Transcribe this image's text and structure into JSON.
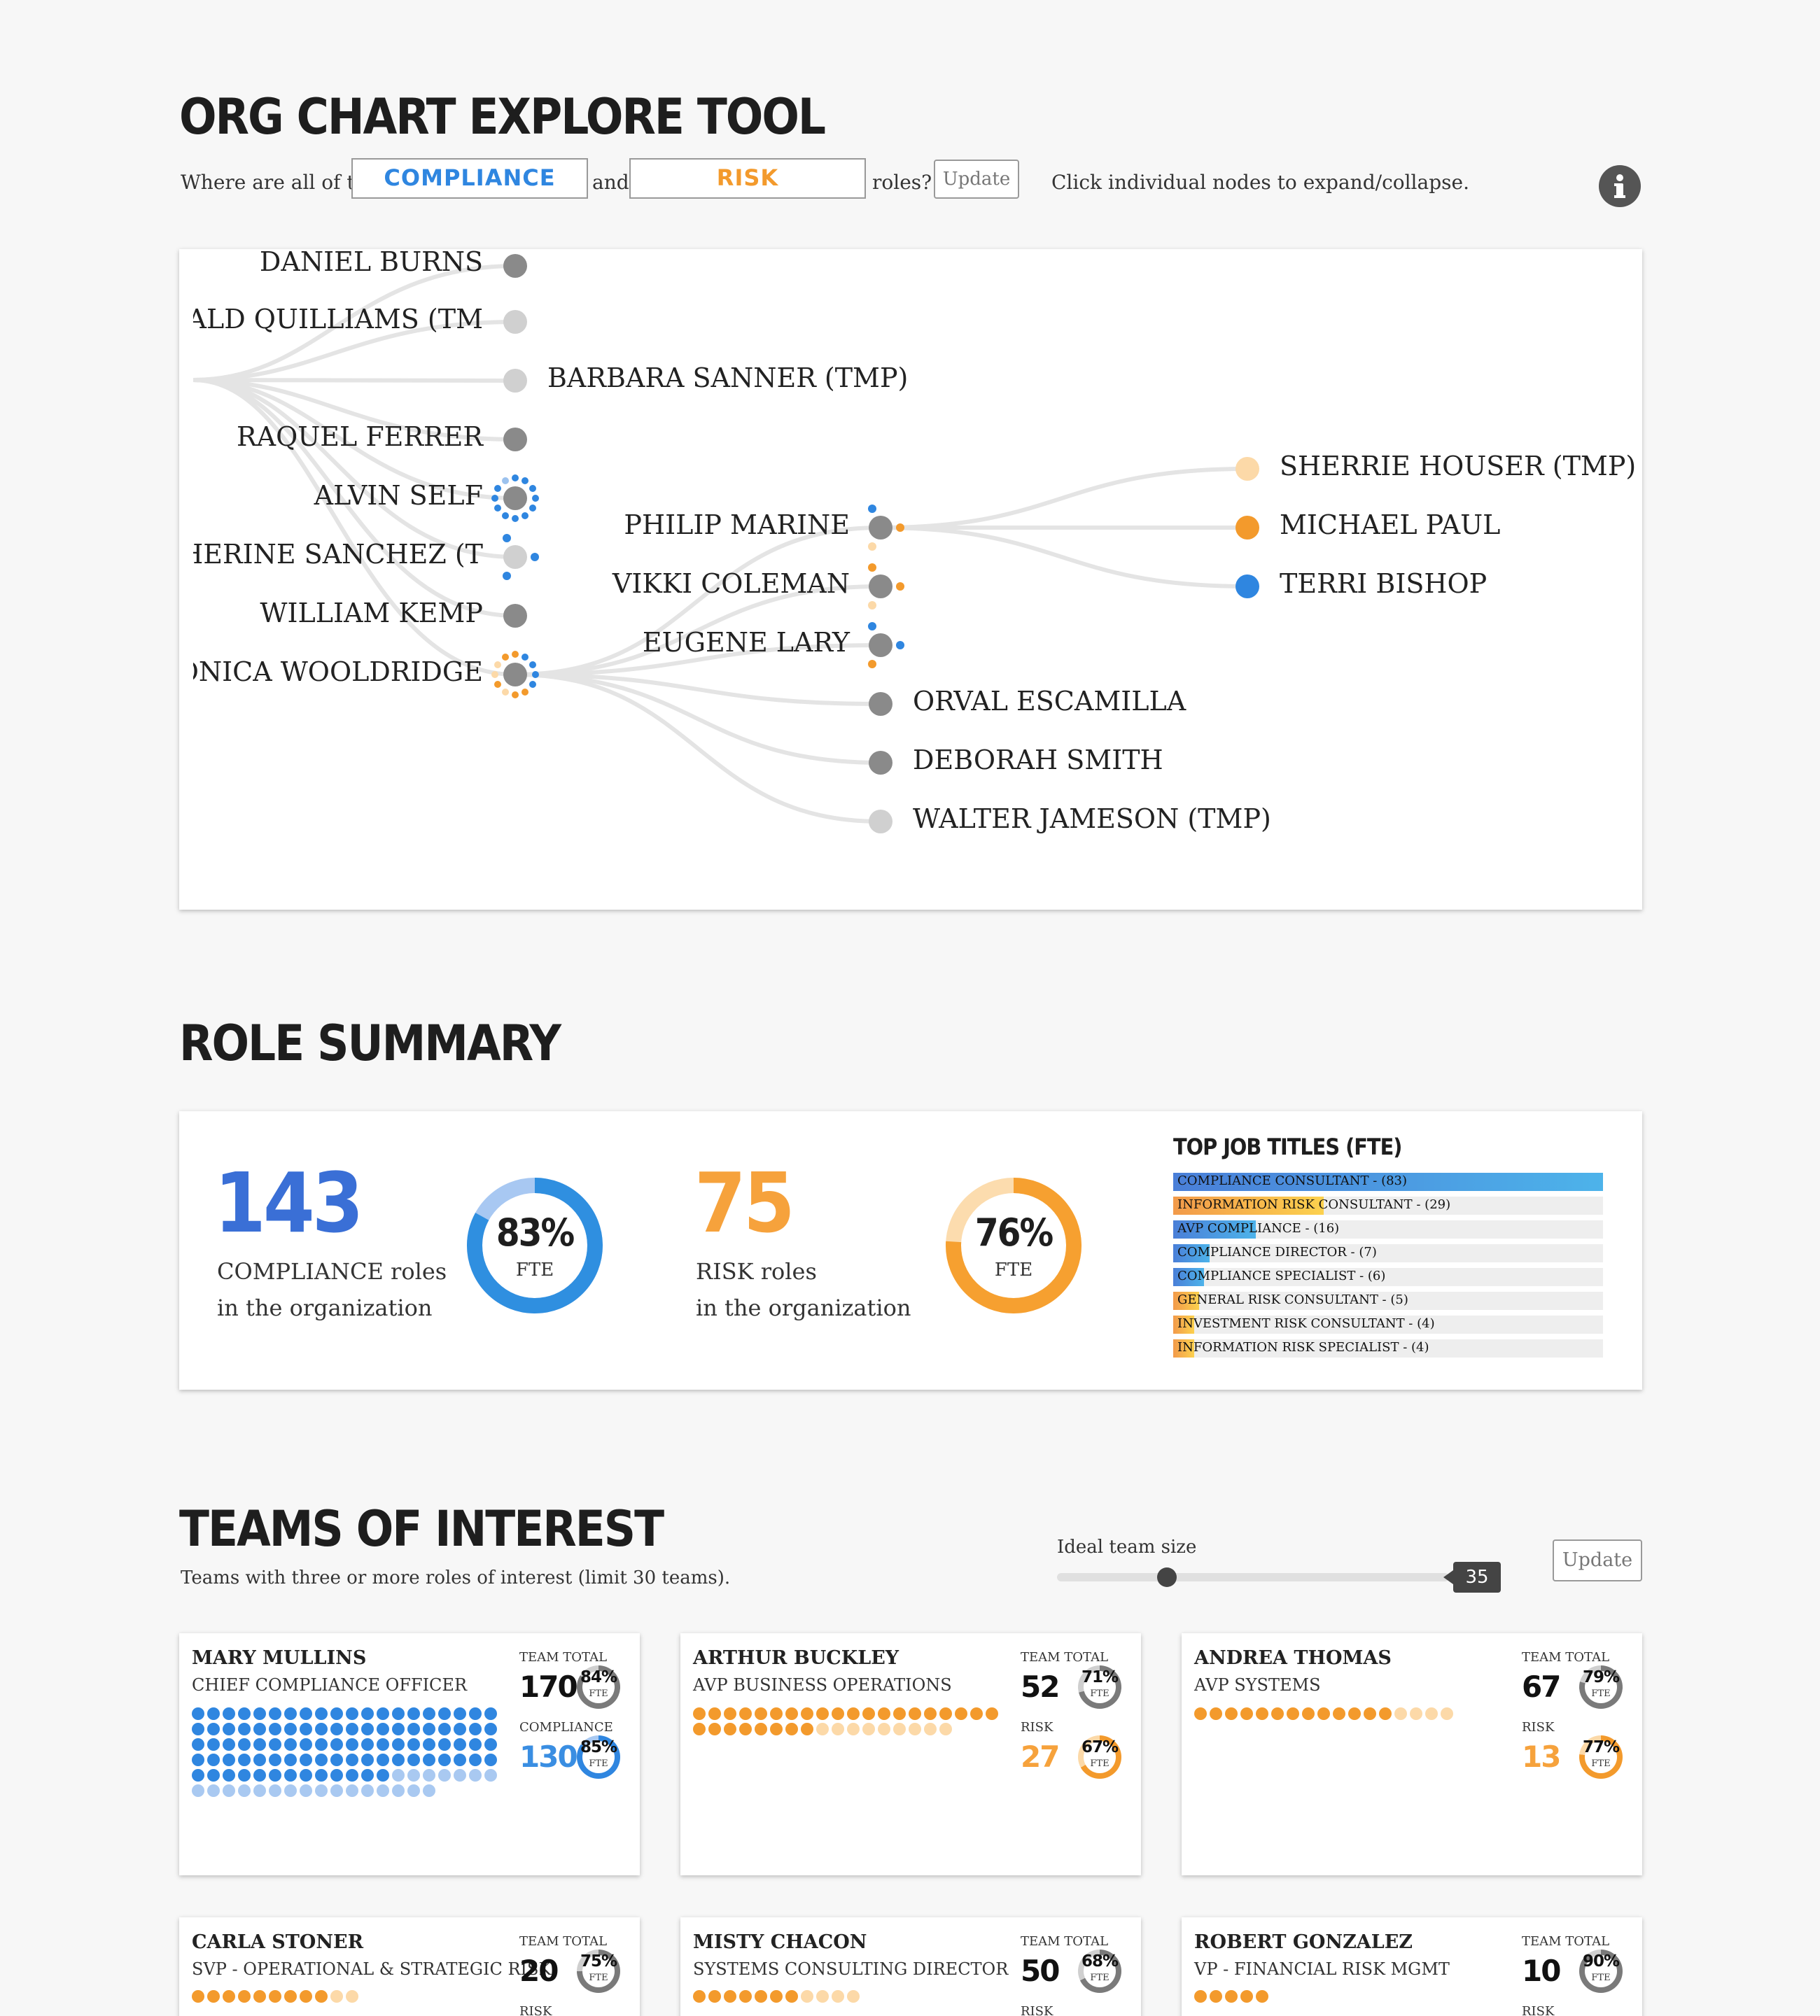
{
  "header": {
    "title": "ORG CHART EXPLORE TOOL",
    "prompt_prefix": "Where are all of the",
    "role1": "COMPLIANCE",
    "connector": "and",
    "role2": "RISK",
    "prompt_suffix": "roles?",
    "update_label": "Update",
    "hint": "Click individual nodes to expand/collapse."
  },
  "colors": {
    "compliance": "#2f86e0",
    "risk": "#f39a2c",
    "node_gray": "#8a8a8a"
  },
  "org_chart": {
    "level1": [
      "DANIEL BURNS",
      "ONALD QUILLIAMS (TM",
      "BARBARA SANNER (TMP)",
      "RAQUEL FERRER",
      "ALVIN SELF",
      "ATHERINE SANCHEZ (T",
      "WILLIAM KEMP",
      "ONICA WOOLDRIDGE"
    ],
    "level2": [
      "PHILIP MARINE",
      "VIKKI COLEMAN",
      "EUGENE LARY",
      "ORVAL ESCAMILLA",
      "DEBORAH SMITH",
      "WALTER JAMESON (TMP)"
    ],
    "level3": [
      "SHERRIE HOUSER (TMP)",
      "MICHAEL PAUL",
      "TERRI BISHOP"
    ]
  },
  "role_summary": {
    "title": "ROLE SUMMARY",
    "compliance_count": "143",
    "compliance_line1": "COMPLIANCE roles",
    "compliance_line2": "in the organization",
    "compliance_fte": "83%",
    "compliance_fte_value": 83,
    "risk_count": "75",
    "risk_line1": "RISK roles",
    "risk_line2": "in the organization",
    "risk_fte": "76%",
    "risk_fte_value": 76,
    "fte_label": "FTE",
    "top_titles_heading": "TOP JOB TITLES (FTE)",
    "top_titles": [
      {
        "label": "COMPLIANCE CONSULTANT - (83)",
        "value": 83,
        "kind": "compliance"
      },
      {
        "label": "INFORMATION RISK CONSULTANT - (29)",
        "value": 29,
        "kind": "risk"
      },
      {
        "label": "AVP COMPLIANCE - (16)",
        "value": 16,
        "kind": "compliance"
      },
      {
        "label": "COMPLIANCE DIRECTOR - (7)",
        "value": 7,
        "kind": "compliance"
      },
      {
        "label": "COMPLIANCE SPECIALIST - (6)",
        "value": 6,
        "kind": "compliance"
      },
      {
        "label": "GENERAL RISK CONSULTANT - (5)",
        "value": 5,
        "kind": "risk"
      },
      {
        "label": "INVESTMENT RISK CONSULTANT - (4)",
        "value": 4,
        "kind": "risk"
      },
      {
        "label": "INFORMATION RISK SPECIALIST - (4)",
        "value": 4,
        "kind": "risk"
      }
    ]
  },
  "teams": {
    "title": "TEAMS OF INTEREST",
    "subtitle": "Teams with three or more roles of interest (limit 30 teams).",
    "slider_label": "Ideal team size",
    "slider_value": "35",
    "slider_fraction": 0.28,
    "update_label": "Update",
    "team_total_label": "TEAM TOTAL",
    "fte_label": "FTE",
    "cards": [
      {
        "name": "MARY MULLINS",
        "title": "CHIEF COMPLIANCE OFFICER",
        "total": "170",
        "total_pct": "84%",
        "role_label": "COMPLIANCE",
        "role_count": "130",
        "role_pct": "85%",
        "kind": "compliance"
      },
      {
        "name": "ARTHUR BUCKLEY",
        "title": "AVP BUSINESS OPERATIONS",
        "total": "52",
        "total_pct": "71%",
        "role_label": "RISK",
        "role_count": "27",
        "role_pct": "67%",
        "kind": "risk"
      },
      {
        "name": "ANDREA THOMAS",
        "title": "AVP SYSTEMS",
        "total": "67",
        "total_pct": "79%",
        "role_label": "RISK",
        "role_count": "13",
        "role_pct": "77%",
        "kind": "risk"
      },
      {
        "name": "CARLA STONER",
        "title": "SVP - OPERATIONAL & STRATEGIC RISK",
        "total": "20",
        "total_pct": "75%",
        "role_label": "RISK",
        "kind": "risk"
      },
      {
        "name": "MISTY CHACON",
        "title": "SYSTEMS CONSULTING DIRECTOR",
        "total": "50",
        "total_pct": "68%",
        "role_label": "RISK",
        "kind": "risk"
      },
      {
        "name": "ROBERT GONZALEZ",
        "title": "VP - FINANCIAL RISK MGMT",
        "total": "10",
        "total_pct": "90%",
        "role_label": "RISK",
        "kind": "risk"
      }
    ]
  }
}
